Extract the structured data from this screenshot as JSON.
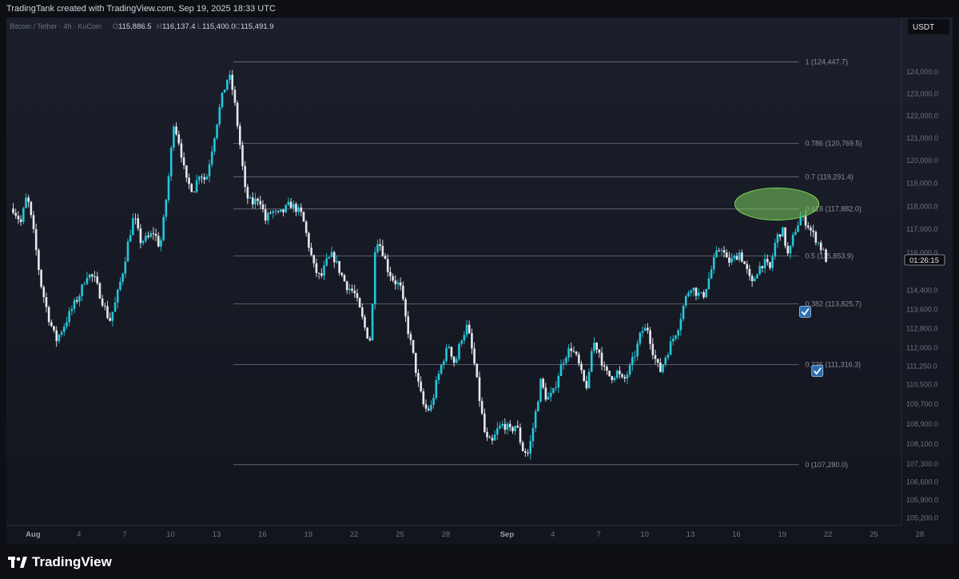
{
  "header": {
    "credit": "TradingTank created with TradingView.com, Sep 19, 2025 18:33 UTC"
  },
  "symbol": {
    "name": "Bitcoin / Tether · 4h · KuCoin",
    "o_label": "O",
    "o": "115,886.5",
    "h_label": "H",
    "h": "116,137.4",
    "l_label": "L",
    "l": "115,400.0",
    "c_label": "C",
    "c": "115,491.9"
  },
  "currency_badge": "USDT",
  "countdown": "01:26:15",
  "footer": {
    "brand": "TradingView"
  },
  "colors": {
    "bull": "#26c6da",
    "bear": "#e6e8ee",
    "fib": "#6b7280",
    "highlight": "#7ccf5b"
  },
  "chart_data": {
    "type": "candlestick",
    "title": "",
    "y_axis": {
      "scale": "log",
      "ylim": [
        104900,
        126500
      ]
    },
    "y_ticks": [
      {
        "v": 124000,
        "label": "124,000.0"
      },
      {
        "v": 123000,
        "label": "123,000.0"
      },
      {
        "v": 122000,
        "label": "122,000.0"
      },
      {
        "v": 121000,
        "label": "121,000.0"
      },
      {
        "v": 120000,
        "label": "120,000.0"
      },
      {
        "v": 119000,
        "label": "119,000.0"
      },
      {
        "v": 118000,
        "label": "118,000.0"
      },
      {
        "v": 117000,
        "label": "117,000.0"
      },
      {
        "v": 116000,
        "label": "116,000.0"
      },
      {
        "v": 114400,
        "label": "114,400.0"
      },
      {
        "v": 113600,
        "label": "113,600.0"
      },
      {
        "v": 112800,
        "label": "112,800.0"
      },
      {
        "v": 112000,
        "label": "112,000.0"
      },
      {
        "v": 111250,
        "label": "111,250.0"
      },
      {
        "v": 110500,
        "label": "110,500.0"
      },
      {
        "v": 109700,
        "label": "109,700.0"
      },
      {
        "v": 108900,
        "label": "108,900.0"
      },
      {
        "v": 108100,
        "label": "108,100.0"
      },
      {
        "v": 107300,
        "label": "107,300.0"
      },
      {
        "v": 106600,
        "label": "106,600.0"
      },
      {
        "v": 105900,
        "label": "105,900.0"
      },
      {
        "v": 105200,
        "label": "105,200.0"
      }
    ],
    "x_ticks": [
      {
        "day": 1,
        "label": "Aug",
        "bold": true
      },
      {
        "day": 4,
        "label": "4"
      },
      {
        "day": 7,
        "label": "7"
      },
      {
        "day": 10,
        "label": "10"
      },
      {
        "day": 13,
        "label": "13"
      },
      {
        "day": 16,
        "label": "16"
      },
      {
        "day": 19,
        "label": "19"
      },
      {
        "day": 22,
        "label": "22"
      },
      {
        "day": 25,
        "label": "25"
      },
      {
        "day": 28,
        "label": "28"
      },
      {
        "day": 32,
        "label": "Sep",
        "bold": true
      },
      {
        "day": 35,
        "label": "4"
      },
      {
        "day": 38,
        "label": "7"
      },
      {
        "day": 41,
        "label": "10"
      },
      {
        "day": 44,
        "label": "13"
      },
      {
        "day": 47,
        "label": "16"
      },
      {
        "day": 50,
        "label": "19"
      },
      {
        "day": 53,
        "label": "22"
      },
      {
        "day": 56,
        "label": "25"
      },
      {
        "day": 59,
        "label": "28"
      }
    ],
    "fib_levels": [
      {
        "ratio": "1",
        "price": 124447.7,
        "label": "1 (124,447.7)"
      },
      {
        "ratio": "0.786",
        "price": 120769.5,
        "label": "0.786 (120,769.5)"
      },
      {
        "ratio": "0.7",
        "price": 119291.4,
        "label": "0.7 (119,291.4)"
      },
      {
        "ratio": "0.618",
        "price": 117882.0,
        "label": "0.618 (117,882.0)"
      },
      {
        "ratio": "0.5",
        "price": 115853.9,
        "label": "0.5 (115,853.9)"
      },
      {
        "ratio": "0.382",
        "price": 113825.7,
        "label": "0.382 (113,825.7)"
      },
      {
        "ratio": "0.236",
        "price": 111316.3,
        "label": "0.236 (111,316.3)"
      },
      {
        "ratio": "0",
        "price": 107280.0,
        "label": "0 (107,280.0)"
      }
    ],
    "fib_start_day": 14.1,
    "fib_label_day": 51.5,
    "highlight_zone": {
      "day_from": 46.9,
      "day_to": 52.4,
      "price_low": 117400,
      "price_high": 118800
    },
    "checkmarks": [
      {
        "day": 51.5,
        "price": 113500
      },
      {
        "day": 52.3,
        "price": 111050
      }
    ],
    "last_price": 115491.9,
    "anchors": [
      [
        -0.3,
        117900
      ],
      [
        0.2,
        117300
      ],
      [
        0.6,
        118500
      ],
      [
        1.0,
        117000
      ],
      [
        1.5,
        114700
      ],
      [
        2.0,
        113300
      ],
      [
        2.5,
        112300
      ],
      [
        3.0,
        112900
      ],
      [
        3.6,
        113700
      ],
      [
        4.1,
        114300
      ],
      [
        4.5,
        115100
      ],
      [
        5.0,
        114900
      ],
      [
        5.5,
        114000
      ],
      [
        6.0,
        113100
      ],
      [
        6.4,
        113900
      ],
      [
        6.9,
        115300
      ],
      [
        7.2,
        116400
      ],
      [
        7.6,
        117600
      ],
      [
        8.0,
        116500
      ],
      [
        8.5,
        116600
      ],
      [
        8.9,
        116900
      ],
      [
        9.3,
        116200
      ],
      [
        9.6,
        117700
      ],
      [
        9.9,
        119500
      ],
      [
        10.2,
        121700
      ],
      [
        10.6,
        120700
      ],
      [
        11.0,
        119100
      ],
      [
        11.5,
        118700
      ],
      [
        11.9,
        119500
      ],
      [
        12.3,
        119100
      ],
      [
        12.8,
        120900
      ],
      [
        13.3,
        122700
      ],
      [
        13.8,
        123900
      ],
      [
        14.1,
        123000
      ],
      [
        14.5,
        120900
      ],
      [
        14.9,
        118500
      ],
      [
        15.3,
        118100
      ],
      [
        15.8,
        118400
      ],
      [
        16.2,
        117400
      ],
      [
        16.6,
        117800
      ],
      [
        17.0,
        117600
      ],
      [
        17.4,
        117800
      ],
      [
        17.8,
        118100
      ],
      [
        18.2,
        117900
      ],
      [
        18.6,
        117600
      ],
      [
        19.0,
        116400
      ],
      [
        19.4,
        115300
      ],
      [
        19.8,
        114900
      ],
      [
        20.2,
        115600
      ],
      [
        20.6,
        115900
      ],
      [
        21.0,
        115300
      ],
      [
        21.5,
        114600
      ],
      [
        22.0,
        114300
      ],
      [
        22.4,
        113500
      ],
      [
        22.8,
        112600
      ],
      [
        23.1,
        112300
      ],
      [
        23.4,
        116700
      ],
      [
        23.8,
        116200
      ],
      [
        24.2,
        115300
      ],
      [
        24.6,
        114800
      ],
      [
        25.0,
        114600
      ],
      [
        25.4,
        113100
      ],
      [
        25.8,
        111900
      ],
      [
        26.2,
        110500
      ],
      [
        26.6,
        109500
      ],
      [
        27.0,
        109500
      ],
      [
        27.4,
        110600
      ],
      [
        27.8,
        111500
      ],
      [
        28.2,
        112100
      ],
      [
        28.6,
        111300
      ],
      [
        29.0,
        112400
      ],
      [
        29.4,
        112900
      ],
      [
        29.8,
        111600
      ],
      [
        30.2,
        109900
      ],
      [
        30.6,
        108300
      ],
      [
        31.0,
        108100
      ],
      [
        31.4,
        108700
      ],
      [
        31.8,
        108900
      ],
      [
        32.2,
        108600
      ],
      [
        32.6,
        108900
      ],
      [
        33.0,
        107900
      ],
      [
        33.4,
        107700
      ],
      [
        33.8,
        109100
      ],
      [
        34.2,
        110600
      ],
      [
        34.6,
        109900
      ],
      [
        35.0,
        110100
      ],
      [
        35.4,
        111000
      ],
      [
        35.8,
        111700
      ],
      [
        36.2,
        112000
      ],
      [
        36.6,
        111500
      ],
      [
        37.0,
        110600
      ],
      [
        37.3,
        110400
      ],
      [
        37.6,
        112300
      ],
      [
        38.0,
        111900
      ],
      [
        38.4,
        111000
      ],
      [
        38.8,
        110800
      ],
      [
        39.2,
        111000
      ],
      [
        39.6,
        110600
      ],
      [
        40.0,
        111100
      ],
      [
        40.4,
        111800
      ],
      [
        40.8,
        112700
      ],
      [
        41.2,
        112800
      ],
      [
        41.6,
        111700
      ],
      [
        42.0,
        111000
      ],
      [
        42.4,
        111700
      ],
      [
        42.8,
        112300
      ],
      [
        43.2,
        112900
      ],
      [
        43.6,
        113900
      ],
      [
        44.0,
        114600
      ],
      [
        44.4,
        114300
      ],
      [
        44.8,
        114100
      ],
      [
        45.2,
        114900
      ],
      [
        45.6,
        115800
      ],
      [
        46.0,
        116300
      ],
      [
        46.4,
        115600
      ],
      [
        46.8,
        115700
      ],
      [
        47.2,
        116000
      ],
      [
        47.6,
        115400
      ],
      [
        48.0,
        114600
      ],
      [
        48.4,
        115300
      ],
      [
        48.8,
        115600
      ],
      [
        49.2,
        115300
      ],
      [
        49.6,
        116600
      ],
      [
        50.0,
        117000
      ],
      [
        50.4,
        115800
      ],
      [
        50.8,
        116900
      ],
      [
        51.2,
        117500
      ],
      [
        51.6,
        117300
      ],
      [
        51.9,
        116900
      ],
      [
        52.3,
        116500
      ],
      [
        52.7,
        116000
      ],
      [
        53.0,
        115500
      ]
    ]
  }
}
